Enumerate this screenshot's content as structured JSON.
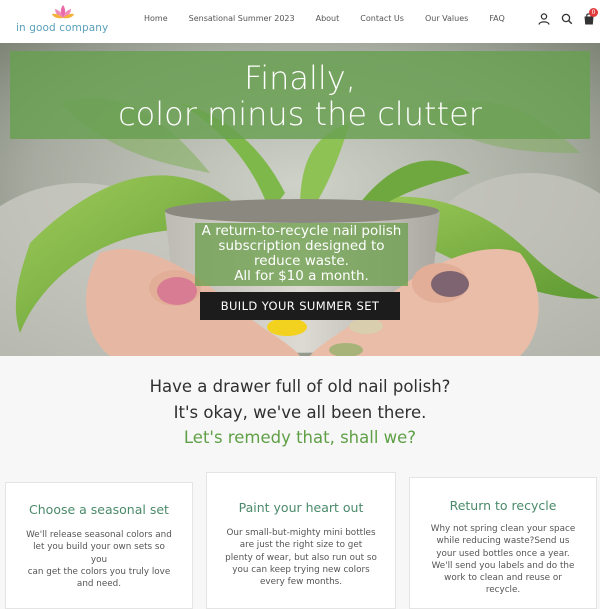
{
  "brand": {
    "name": "in good company",
    "colors": {
      "accent": "#5fa046",
      "logo_text": "#5aa0b8",
      "badge": "#e23b3b",
      "cta_bg": "#1c1c1c"
    }
  },
  "nav": {
    "items": [
      "Home",
      "Sensational Summer 2023",
      "About",
      "Contact Us",
      "Our Values",
      "FAQ"
    ],
    "icons": [
      "user-icon",
      "search-icon",
      "cart-icon"
    ],
    "cart_count": "0"
  },
  "hero": {
    "title_line1": "Finally,",
    "title_line2": "color minus the clutter",
    "sub_lines": [
      "A return-to-recycle nail polish",
      "subscription designed to",
      "reduce waste.",
      "All for $10 a month."
    ],
    "cta": "BUILD YOUR SUMMER SET"
  },
  "intro": {
    "line1": "Have a drawer full of old nail polish?",
    "line2": "It's okay, we've all been there.",
    "line3": "Let's remedy that, shall we?"
  },
  "cards": [
    {
      "title": "Choose a seasonal set",
      "body_lines": [
        "We'll release seasonal colors and",
        "let you build your own sets so you",
        "can get the colors you truly love",
        "and need."
      ]
    },
    {
      "title": "Paint your heart out",
      "body_lines": [
        "Our small-but-mighty mini bottles",
        "are just the right size to get",
        "plenty of wear, but also run out so",
        "you can keep trying new colors",
        "every few months."
      ]
    },
    {
      "title": "Return to recycle",
      "body_lines": [
        "Why not spring clean your space",
        "while reducing waste?Send us",
        "your used bottles once a year.",
        "We'll send you labels and do the",
        "work to clean and reuse or",
        "recycle."
      ]
    }
  ]
}
